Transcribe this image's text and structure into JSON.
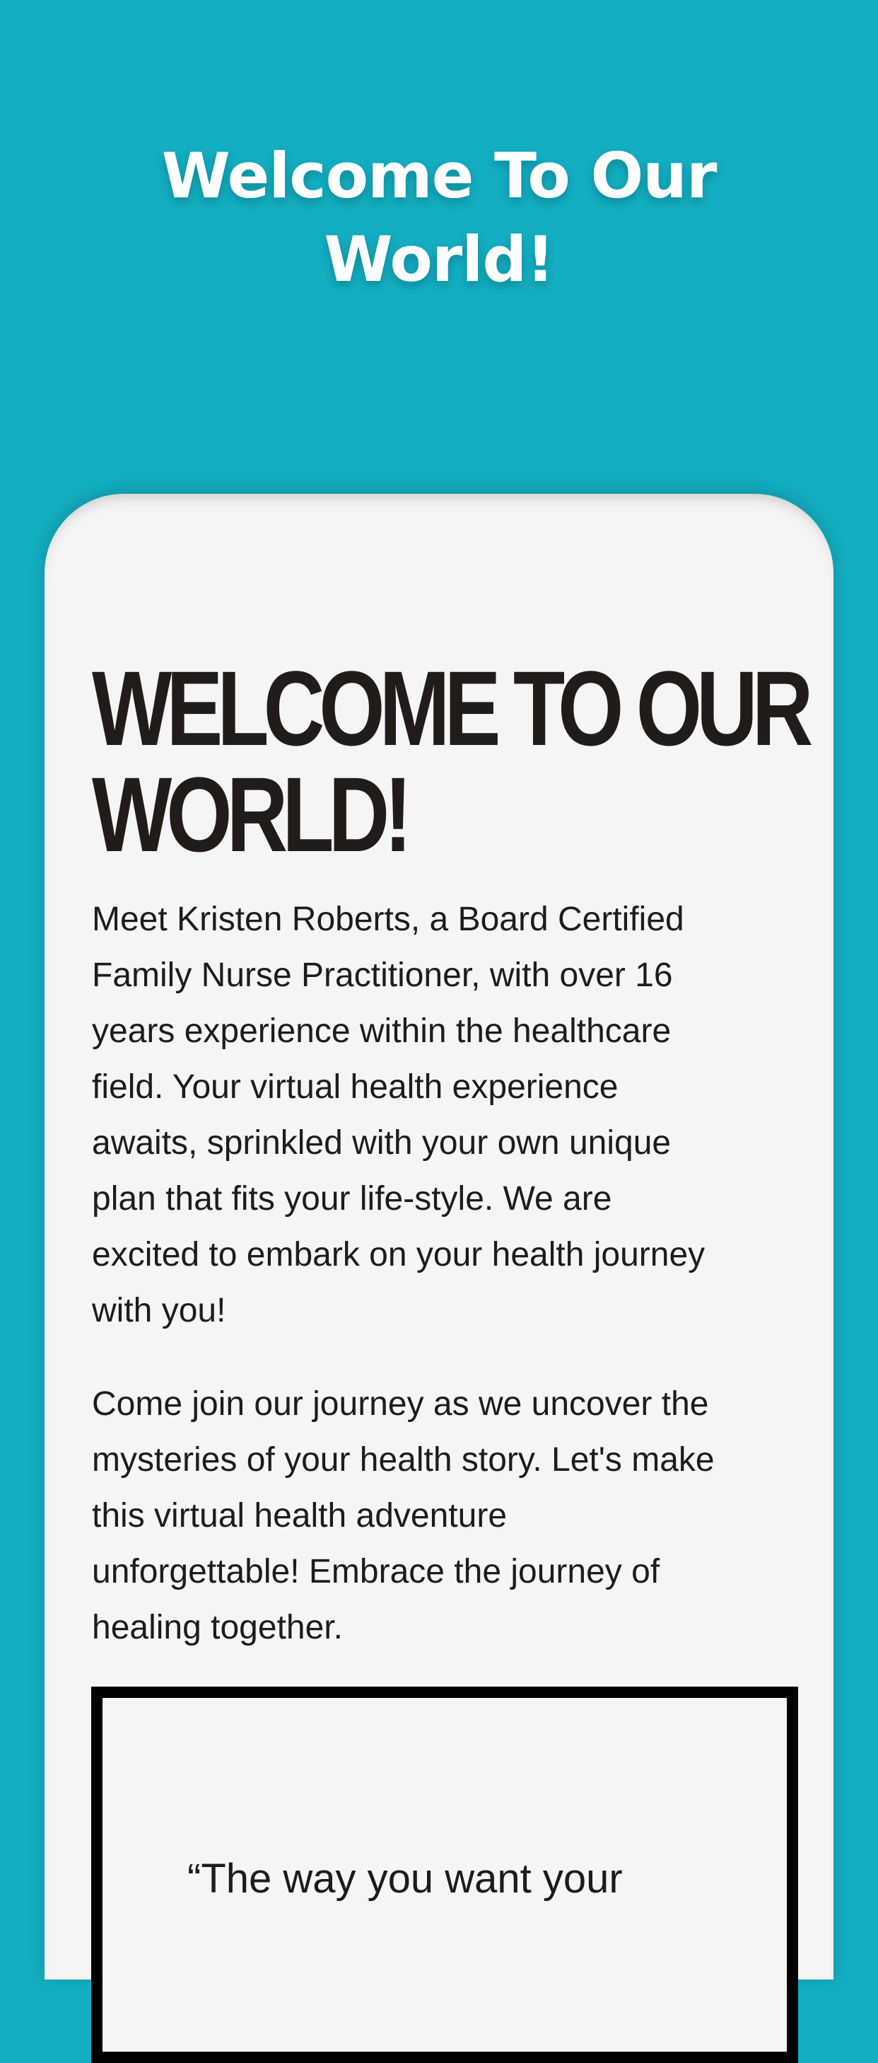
{
  "hero": {
    "title_line1": "Welcome To Our",
    "title_line2": "World!"
  },
  "card": {
    "heading_line1": "WELCOME TO OUR",
    "heading_line2": "WORLD!",
    "paragraph1_lines": [
      "Meet Kristen Roberts, a Board Certified",
      "Family Nurse Practitioner, with over 16",
      "years experience within the healthcare",
      "field.  Your virtual health experience",
      "awaits, sprinkled with your own unique",
      "plan that fits your life-style. We are",
      "excited to embark on your health journey",
      "with you!"
    ],
    "paragraph2_lines": [
      "Come join our  journey as we uncover the",
      "mysteries of your health story. Let's make",
      "this virtual health adventure",
      "unforgettable! Embrace the journey of",
      "healing together."
    ],
    "quote": "“The way you want your"
  },
  "colors": {
    "background": "#13aec2",
    "card": "#f5f5f5",
    "heading": "#211c1a",
    "text": "#1d1b1b",
    "border": "#000000"
  }
}
